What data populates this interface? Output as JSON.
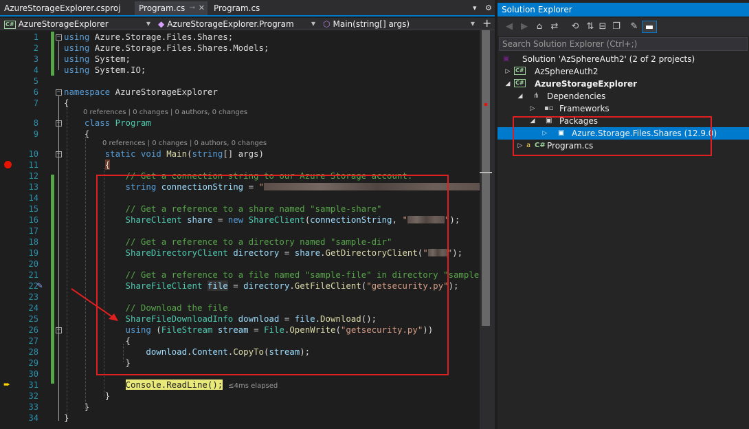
{
  "tabs": [
    {
      "label": "AzureStorageExplorer.csproj"
    },
    {
      "label": "Program.cs",
      "active": true
    },
    {
      "label": "Program.cs"
    }
  ],
  "navbar": {
    "project": "AzureStorageExplorer",
    "class": "AzureStorageExplorer.Program",
    "member": "Main(string[] args)"
  },
  "codelens": {
    "class": "0 references | 0 changes | 0 authors, 0 changes",
    "method": "0 references | 0 changes | 0 authors, 0 changes"
  },
  "line_numbers": [
    "1",
    "2",
    "3",
    "4",
    "5",
    "6",
    "7",
    "8",
    "9",
    "10",
    "11",
    "12",
    "13",
    "14",
    "15",
    "16",
    "17",
    "18",
    "19",
    "20",
    "21",
    "22",
    "23",
    "24",
    "25",
    "26",
    "27",
    "28",
    "29",
    "30",
    "31",
    "32",
    "33",
    "34"
  ],
  "code": {
    "using": "using",
    "ns1": "Azure.Storage.Files.Shares;",
    "ns2": "Azure.Storage.Files.Shares.Models;",
    "ns3": "System;",
    "ns4": "System.IO;",
    "namespace_kw": "namespace",
    "namespace_name": "AzureStorageExplorer",
    "class_kw": "class",
    "class_name": "Program",
    "static_void": "static void",
    "main": "Main",
    "string_kw": "string",
    "args_sig": "[] args)",
    "c12": "// Get a connection string to our Azure Storage account.",
    "c14": "// Get a reference to a share named \"sample-share\"",
    "c17": "// Get a reference to a directory named \"sample-dir\"",
    "c20": "// Get a reference to a file named \"sample-file\" in directory \"sample-dir\"",
    "c23": "// Download the file",
    "connectionString": "connectionString",
    "ShareClient": "ShareClient",
    "share": "share",
    "new": "new",
    "ShareDirectoryClient": "ShareDirectoryClient",
    "directory": "directory",
    "GetDirectoryClient": "GetDirectoryClient",
    "ShareFileClient": "ShareFileClient",
    "file": "file",
    "GetFileClient": "GetFileClient",
    "getsecurity": "\"getsecurity.py\"",
    "ShareFileDownloadInfo": "ShareFileDownloadInfo",
    "download": "download",
    "Download": "Download",
    "using_kw": "using",
    "FileStream": "FileStream",
    "stream": "stream",
    "File": "File",
    "OpenWrite": "OpenWrite",
    "Content": "Content",
    "CopyTo": "CopyTo",
    "console_readline": "Console.ReadLine();",
    "elapsed": "≤4ms elapsed"
  },
  "solution_explorer": {
    "title": "Solution Explorer",
    "search_placeholder": "Search Solution Explorer (Ctrl+;)",
    "nodes": [
      {
        "label": "Solution 'AzSphereAuth2' (2 of 2 projects)"
      },
      {
        "label": "AzSphereAuth2"
      },
      {
        "label": "AzureStorageExplorer"
      },
      {
        "label": "Dependencies"
      },
      {
        "label": "Frameworks"
      },
      {
        "label": "Packages"
      },
      {
        "label": "Azure.Storage.Files.Shares (12.9.0)"
      },
      {
        "label": "Program.cs"
      }
    ]
  },
  "colors": {
    "accent": "#007acc",
    "highlight_box": "#e02020",
    "keyword": "#569cd6",
    "type": "#4ec9b0",
    "string": "#d69d85",
    "comment": "#57a64a"
  }
}
